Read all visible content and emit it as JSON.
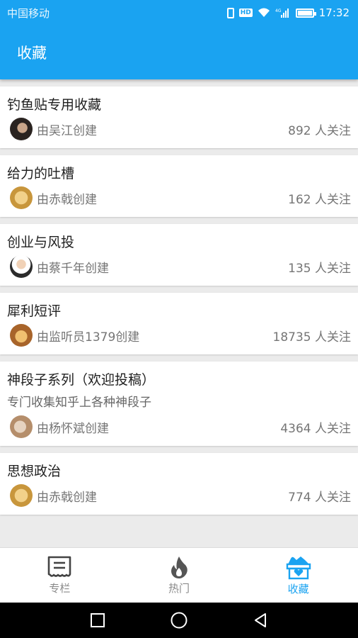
{
  "status_bar": {
    "carrier": "中国移动",
    "hd_badge": "HD",
    "network": "4G",
    "time": "17:32"
  },
  "app_bar": {
    "title": "收藏"
  },
  "collections": [
    {
      "title": "钓鱼贴专用收藏",
      "creator": "由吴江创建",
      "followers": "892 人关注",
      "avatar": "dark-portrait"
    },
    {
      "title": "给力的吐槽",
      "creator": "由赤戟创建",
      "followers": "162 人关注",
      "avatar": "cheetah"
    },
    {
      "title": "创业与风投",
      "creator": "由蔡千年创建",
      "followers": "135 人关注",
      "avatar": "man-in-suit"
    },
    {
      "title": "犀利短评",
      "creator": "由监听员1379创建",
      "followers": "18735 人关注",
      "avatar": "bread"
    },
    {
      "title": "神段子系列（欢迎投稿）",
      "description": "专门收集知乎上各种神段子",
      "creator": "由杨怀斌创建",
      "followers": "4364 人关注",
      "avatar": "cartoon"
    },
    {
      "title": "思想政治",
      "creator": "由赤戟创建",
      "followers": "774 人关注",
      "avatar": "cheetah"
    }
  ],
  "tabs": [
    {
      "label": "专栏",
      "icon": "column-icon",
      "active": false
    },
    {
      "label": "热门",
      "icon": "flame-icon",
      "active": false
    },
    {
      "label": "收藏",
      "icon": "collection-box-icon",
      "active": true
    }
  ],
  "colors": {
    "accent": "#1aa3f1",
    "inactive": "#8a8a8a"
  },
  "nav_bar": {
    "icons": [
      "recent-apps-icon",
      "home-icon",
      "back-icon"
    ]
  }
}
